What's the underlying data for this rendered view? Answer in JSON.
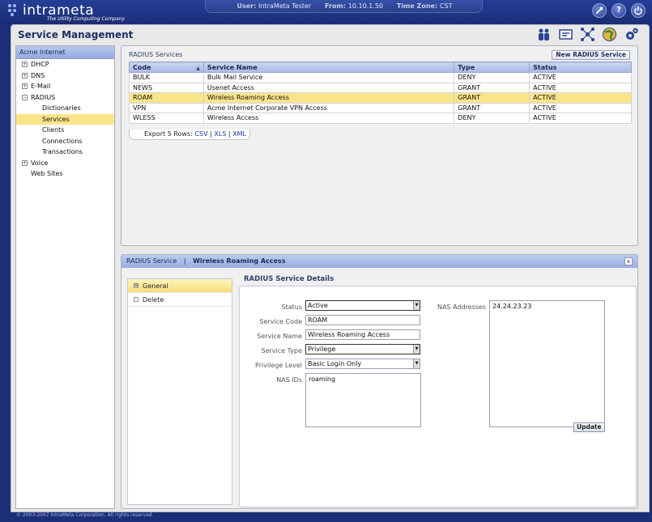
{
  "header": {
    "logo_text": "intrameta",
    "tagline": "The Utility Computing Company",
    "user_label": "User:",
    "user_value": "IntraMeta Tester",
    "from_label": "From:",
    "from_value": "10.10.1.50",
    "tz_label": "Time Zone:",
    "tz_value": "CST",
    "icons": [
      "tools-icon",
      "help-icon",
      "power-icon"
    ],
    "help_glyph": "?"
  },
  "page": {
    "title": "Service Management",
    "tool_icons": [
      "users-icon",
      "billing-icon",
      "network-icon",
      "globe-icon",
      "settings-icon"
    ]
  },
  "tree": {
    "root": "Acme Internet",
    "items": [
      {
        "label": "DHCP",
        "expander": "+"
      },
      {
        "label": "DNS",
        "expander": "+"
      },
      {
        "label": "E-Mail",
        "expander": "+"
      },
      {
        "label": "RADIUS",
        "expander": "−"
      },
      {
        "label": "Dictionaries"
      },
      {
        "label": "Services"
      },
      {
        "label": "Clients"
      },
      {
        "label": "Connections"
      },
      {
        "label": "Transactions"
      },
      {
        "label": "Voice",
        "expander": "+"
      },
      {
        "label": "Web Sites"
      }
    ],
    "selected": "Services"
  },
  "grid": {
    "title": "RADIUS Services",
    "new_button": "New RADIUS Service",
    "columns": [
      "Code",
      "Service Name",
      "Type",
      "Status"
    ],
    "rows": [
      [
        "BULK",
        "Bulk Mail Service",
        "DENY",
        "ACTIVE"
      ],
      [
        "NEWS",
        "Usenet Access",
        "GRANT",
        "ACTIVE"
      ],
      [
        "ROAM",
        "Wireless Roaming Access",
        "GRANT",
        "ACTIVE"
      ],
      [
        "VPN",
        "Acme Internet Corporate VPN Access",
        "GRANT",
        "ACTIVE"
      ],
      [
        "WLESS",
        "Wireless Access",
        "DENY",
        "ACTIVE"
      ]
    ],
    "selected_row": "ROAM",
    "export_label": "Export 5 Rows:",
    "export_csv": "CSV",
    "export_xls": "XLS",
    "export_xml": "XML",
    "export_sep": "|"
  },
  "details": {
    "header_section": "RADIUS Service",
    "header_sep": "|",
    "header_item": "Wireless Roaming Access",
    "close_glyph": "x",
    "menu": [
      {
        "label": "General",
        "marker": "⊟"
      },
      {
        "label": "Delete",
        "marker": ""
      }
    ],
    "selected_menu": "General",
    "form_title": "RADIUS Service Details",
    "status_label": "Status",
    "status_value": "Active",
    "code_label": "Service Code",
    "code_value": "ROAM",
    "name_label": "Service Name",
    "name_value": "Wireless Roaming Access",
    "type_label": "Service Type",
    "type_value": "Privilege",
    "priv_label": "Privilege Level",
    "priv_value": "Basic Login Only",
    "nasids_label": "NAS IDs",
    "nasids_value": "roaming",
    "nasaddr_label": "NAS Addresses",
    "nasaddr_value": "24.24.23.23",
    "update_button": "Update"
  },
  "footer": {
    "copyright": "© 2003-2007 IntraMeta Corporation.  All rights reserved."
  }
}
